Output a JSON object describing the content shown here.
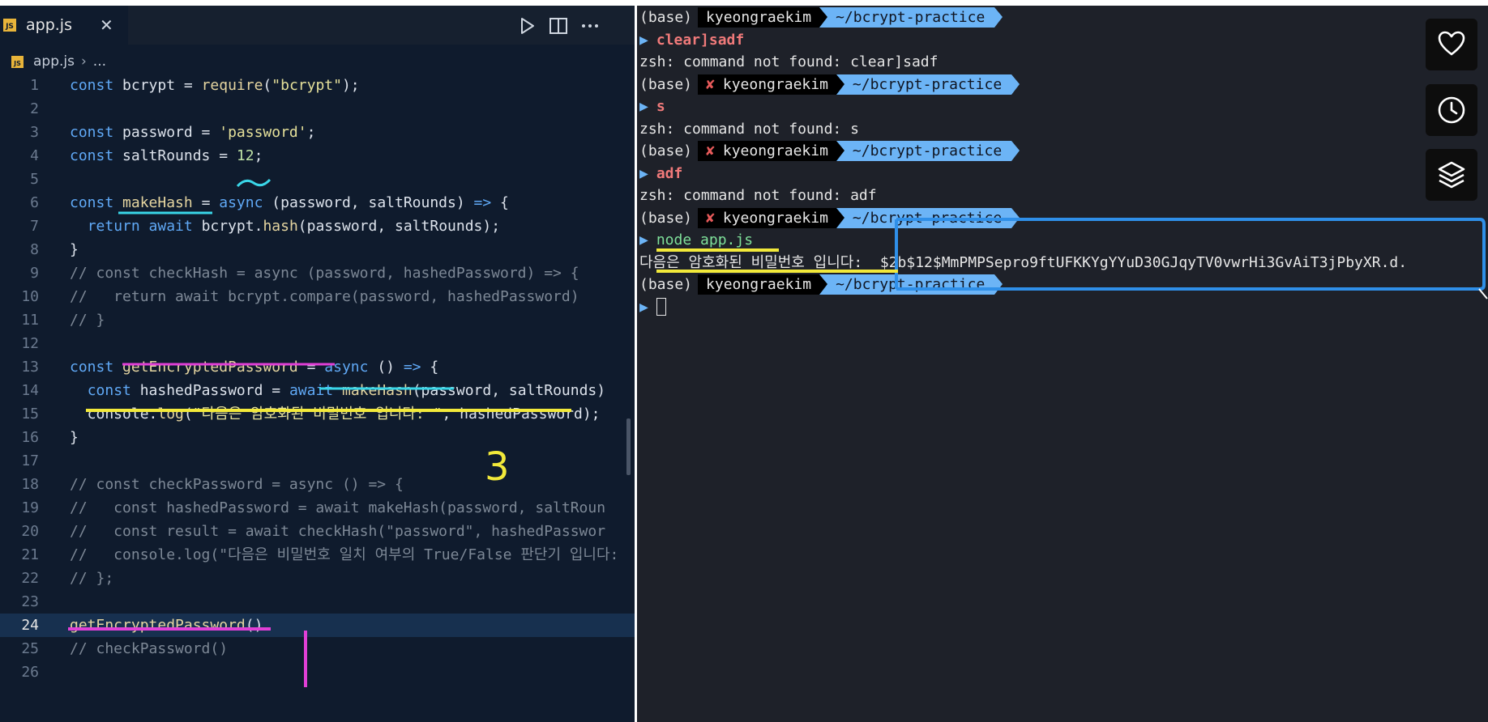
{
  "editor": {
    "tab": {
      "badge": "JS",
      "filename": "app.js",
      "close": "✕"
    },
    "breadcrumb": {
      "badge": "JS",
      "file": "app.js",
      "sep": "›",
      "rest": "..."
    },
    "lines": [
      {
        "n": "1",
        "html": "<span class='k'>const</span> bcrypt = <span class='f'>require</span>(<span class='s'>\"bcrypt\"</span>);"
      },
      {
        "n": "2",
        "html": ""
      },
      {
        "n": "3",
        "html": "<span class='k'>const</span> password = <span class='s'>'password'</span>;"
      },
      {
        "n": "4",
        "html": "<span class='k'>const</span> saltRounds = <span class='n'>12</span>;"
      },
      {
        "n": "5",
        "html": ""
      },
      {
        "n": "6",
        "html": "<span class='k'>const</span> <span class='f'>makeHash</span> = <span class='k'>async</span> (password, saltRounds) <span class='k'>=&gt;</span> {"
      },
      {
        "n": "7",
        "html": "  <span class='k'>return await</span> bcrypt.<span class='f'>hash</span>(password, saltRounds);"
      },
      {
        "n": "8",
        "html": "}"
      },
      {
        "n": "9",
        "html": "<span class='c'>// const checkHash = async (password, hashedPassword) =&gt; {</span>"
      },
      {
        "n": "10",
        "html": "<span class='c'>//   return await bcrypt.compare(password, hashedPassword)</span>"
      },
      {
        "n": "11",
        "html": "<span class='c'>// }</span>"
      },
      {
        "n": "12",
        "html": ""
      },
      {
        "n": "13",
        "html": "<span class='k'>const</span> <span class='f'>getEncryptedPassword</span> = <span class='k'>async</span> () <span class='k'>=&gt;</span> {"
      },
      {
        "n": "14",
        "html": "  <span class='k'>const</span> hashedPassword = <span class='k'>await</span> <span class='f'>makeHash</span>(password, saltRounds)"
      },
      {
        "n": "15",
        "html": "  console.<span class='f'>log</span>(<span class='s'>\"다음은 암호화된 비밀번호 입니다: \"</span>, hashedPassword);"
      },
      {
        "n": "16",
        "html": "}"
      },
      {
        "n": "17",
        "html": ""
      },
      {
        "n": "18",
        "html": "<span class='c'>// const checkPassword = async () =&gt; {</span>"
      },
      {
        "n": "19",
        "html": "<span class='c'>//   const hashedPassword = await makeHash(password, saltRoun</span>"
      },
      {
        "n": "20",
        "html": "<span class='c'>//   const result = await checkHash(\"password\", hashedPasswor</span>"
      },
      {
        "n": "21",
        "html": "<span class='c'>//   console.log(\"다음은 비밀번호 일치 여부의 True/False 판단기 입니다:</span>"
      },
      {
        "n": "22",
        "html": "<span class='c'>// };</span>"
      },
      {
        "n": "23",
        "html": ""
      },
      {
        "n": "24",
        "html": "<span class='f'>getEncryptedPassword</span>()",
        "active": true
      },
      {
        "n": "25",
        "html": "<span class='c'>// checkPassword()</span>"
      },
      {
        "n": "26",
        "html": ""
      }
    ],
    "annotation_digit": "3"
  },
  "terminal": {
    "lines": [
      {
        "type": "prompt",
        "base": "(base)",
        "err": false,
        "user": "kyeongraekim",
        "path": "~/bcrypt-practice"
      },
      {
        "type": "cmd",
        "status": "err",
        "text": "clear]sadf"
      },
      {
        "type": "out",
        "text": "zsh: command not found: clear]sadf"
      },
      {
        "type": "prompt",
        "base": "(base)",
        "err": true,
        "user": "kyeongraekim",
        "path": "~/bcrypt-practice"
      },
      {
        "type": "cmd",
        "status": "err",
        "text": "s"
      },
      {
        "type": "out",
        "text": "zsh: command not found: s"
      },
      {
        "type": "prompt",
        "base": "(base)",
        "err": true,
        "user": "kyeongraekim",
        "path": "~/bcrypt-practice"
      },
      {
        "type": "cmd",
        "status": "err",
        "text": "adf"
      },
      {
        "type": "out",
        "text": "zsh: command not found: adf"
      },
      {
        "type": "prompt",
        "base": "(base)",
        "err": true,
        "user": "kyeongraekim",
        "path": "~/bcrypt-practice"
      },
      {
        "type": "cmd",
        "status": "ok",
        "text": "node app.js"
      },
      {
        "type": "out",
        "text": "다음은 암호화된 비밀번호 입니다:  $2b$12$MmPMPSepro9ftUFKKYgYYuD30GJqyTV0vwrHi3GvAiT3jPbyXR.d."
      },
      {
        "type": "prompt",
        "base": "(base)",
        "err": false,
        "user": "kyeongraekim",
        "path": "~/bcrypt-practice"
      },
      {
        "type": "cursor"
      }
    ],
    "err_mark": "✘",
    "prompt_mark": "▶"
  },
  "side_buttons": [
    {
      "name": "like-button",
      "icon": "heart-icon"
    },
    {
      "name": "watch-later-button",
      "icon": "clock-icon"
    },
    {
      "name": "layers-button",
      "icon": "layers-icon"
    }
  ],
  "colors": {
    "editor_bg": "#0f1b2d",
    "terminal_bg": "#1e2129",
    "path_segment": "#6cb4f6",
    "error_text": "#f07a7a",
    "annotation_yellow": "#f2e93a",
    "annotation_magenta": "#e13fd6",
    "annotation_cyan": "#3ad6e8"
  }
}
